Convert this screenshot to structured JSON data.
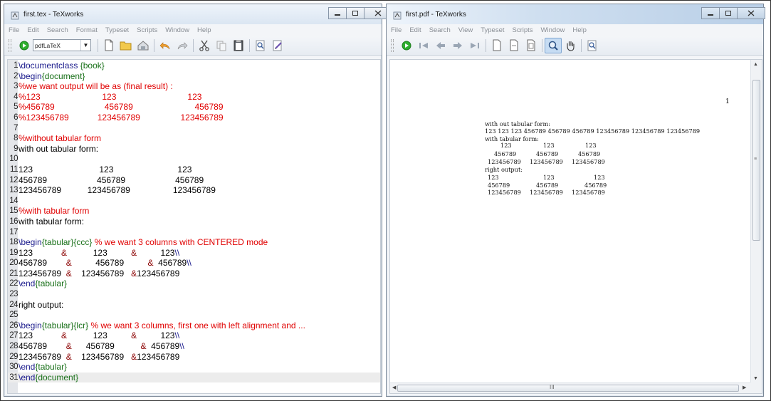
{
  "left_window": {
    "title": "first.tex - TeXworks",
    "menu": [
      "File",
      "Edit",
      "Search",
      "Format",
      "Typeset",
      "Scripts",
      "Window",
      "Help"
    ],
    "engine": "pdfLaTeX",
    "toolbar_icons": [
      "typeset-icon",
      "new-file-icon",
      "open-folder-icon",
      "save-icon",
      "undo-icon",
      "redo-icon",
      "cut-icon",
      "copy-icon",
      "paste-icon",
      "find-icon",
      "replace-icon"
    ]
  },
  "editor_lines": [
    {
      "n": "1",
      "tx": "",
      "segments": [
        {
          "t": "\\documentclass ",
          "c": "cmd"
        },
        {
          "t": "{book}",
          "c": "env"
        }
      ]
    },
    {
      "n": "2",
      "segments": [
        {
          "t": "\\begin",
          "c": "cmd"
        },
        {
          "t": "{document}",
          "c": "env"
        }
      ]
    },
    {
      "n": "3",
      "segments": [
        {
          "t": "%we want output will be as (final result) :",
          "c": "com"
        }
      ]
    },
    {
      "n": "4",
      "segments": [
        {
          "t": "%123                          123                              123",
          "c": "com"
        }
      ]
    },
    {
      "n": "5",
      "segments": [
        {
          "t": "%456789                     456789                          456789",
          "c": "com"
        }
      ]
    },
    {
      "n": "6",
      "segments": [
        {
          "t": "%123456789            123456789                 123456789",
          "c": "com"
        }
      ]
    },
    {
      "n": "7",
      "segments": []
    },
    {
      "n": "8",
      "segments": [
        {
          "t": "%without tabular form",
          "c": "com"
        }
      ]
    },
    {
      "n": "9",
      "segments": [
        {
          "t": "with out tabular form:",
          "c": "txt"
        }
      ]
    },
    {
      "n": "10",
      "segments": []
    },
    {
      "n": "11",
      "segments": [
        {
          "t": "123                            123                           123",
          "c": "txt"
        }
      ]
    },
    {
      "n": "12",
      "segments": [
        {
          "t": "456789                     456789                     456789",
          "c": "txt"
        }
      ]
    },
    {
      "n": "13",
      "segments": [
        {
          "t": "123456789           123456789                  123456789",
          "c": "txt"
        }
      ]
    },
    {
      "n": "14",
      "segments": []
    },
    {
      "n": "15",
      "segments": [
        {
          "t": "%with tabular form",
          "c": "com"
        }
      ]
    },
    {
      "n": "16",
      "segments": [
        {
          "t": "with tabular form:",
          "c": "txt"
        }
      ]
    },
    {
      "n": "17",
      "segments": []
    },
    {
      "n": "18",
      "segments": [
        {
          "t": "\\begin",
          "c": "cmd"
        },
        {
          "t": "{tabular}",
          "c": "env"
        },
        {
          "t": "{ccc} ",
          "c": "env"
        },
        {
          "t": "% we want 3 columns with CENTERED mode",
          "c": "com"
        }
      ]
    },
    {
      "n": "19",
      "segments": [
        {
          "t": "123            ",
          "c": "txt"
        },
        {
          "t": "&",
          "c": "amp"
        },
        {
          "t": "           123          ",
          "c": "txt"
        },
        {
          "t": "&",
          "c": "amp"
        },
        {
          "t": "          123",
          "c": "txt"
        },
        {
          "t": "\\\\",
          "c": "cmd"
        }
      ]
    },
    {
      "n": "20",
      "segments": [
        {
          "t": "456789        ",
          "c": "txt"
        },
        {
          "t": "&",
          "c": "amp"
        },
        {
          "t": "          456789          ",
          "c": "txt"
        },
        {
          "t": "&",
          "c": "amp"
        },
        {
          "t": "  456789",
          "c": "txt"
        },
        {
          "t": "\\\\",
          "c": "cmd"
        }
      ]
    },
    {
      "n": "21",
      "segments": [
        {
          "t": "123456789  ",
          "c": "txt"
        },
        {
          "t": "&",
          "c": "amp"
        },
        {
          "t": "    123456789   ",
          "c": "txt"
        },
        {
          "t": "&",
          "c": "amp"
        },
        {
          "t": "123456789",
          "c": "txt"
        }
      ]
    },
    {
      "n": "22",
      "segments": [
        {
          "t": "\\end",
          "c": "cmd"
        },
        {
          "t": "{tabular}",
          "c": "env"
        }
      ]
    },
    {
      "n": "23",
      "segments": []
    },
    {
      "n": "24",
      "segments": [
        {
          "t": "right output:",
          "c": "txt"
        }
      ]
    },
    {
      "n": "25",
      "segments": []
    },
    {
      "n": "26",
      "segments": [
        {
          "t": "\\begin",
          "c": "cmd"
        },
        {
          "t": "{tabular}",
          "c": "env"
        },
        {
          "t": "{lcr} ",
          "c": "env"
        },
        {
          "t": "% we want 3 columns, first one with left alignment and ...",
          "c": "com"
        }
      ]
    },
    {
      "n": "27",
      "segments": [
        {
          "t": "123            ",
          "c": "txt"
        },
        {
          "t": "&",
          "c": "amp"
        },
        {
          "t": "           123          ",
          "c": "txt"
        },
        {
          "t": "&",
          "c": "amp"
        },
        {
          "t": "          123",
          "c": "txt"
        },
        {
          "t": "\\\\",
          "c": "cmd"
        }
      ]
    },
    {
      "n": "28",
      "segments": [
        {
          "t": "456789        ",
          "c": "txt"
        },
        {
          "t": "&",
          "c": "amp"
        },
        {
          "t": "      456789           ",
          "c": "txt"
        },
        {
          "t": "&",
          "c": "amp"
        },
        {
          "t": "  456789",
          "c": "txt"
        },
        {
          "t": "\\\\",
          "c": "cmd"
        }
      ]
    },
    {
      "n": "29",
      "segments": [
        {
          "t": "123456789  ",
          "c": "txt"
        },
        {
          "t": "&",
          "c": "amp"
        },
        {
          "t": "    123456789   ",
          "c": "txt"
        },
        {
          "t": "&",
          "c": "amp"
        },
        {
          "t": "123456789",
          "c": "txt"
        }
      ]
    },
    {
      "n": "30",
      "segments": [
        {
          "t": "\\end",
          "c": "cmd"
        },
        {
          "t": "{tabular}",
          "c": "env"
        }
      ]
    },
    {
      "n": "31",
      "segments": [
        {
          "t": "\\end",
          "c": "cmd"
        },
        {
          "t": "{document}",
          "c": "env"
        }
      ],
      "current": true
    }
  ],
  "right_window": {
    "title": "first.pdf - TeXworks",
    "menu": [
      "File",
      "Edit",
      "Search",
      "View",
      "Typeset",
      "Scripts",
      "Window",
      "Help"
    ],
    "toolbar_icons": [
      "typeset-icon",
      "first-page-icon",
      "prev-page-icon",
      "next-page-icon",
      "last-page-icon",
      "actual-size-icon",
      "fit-width-icon",
      "fit-window-icon",
      "magnify-icon",
      "hand-icon",
      "find-icon"
    ]
  },
  "pdf": {
    "page_number": "1",
    "lines": [
      "with out tabular form:",
      "123 123 123 456789 456789 456789 123456789 123456789 123456789",
      "with tabular form:",
      "123",
      "123",
      "123",
      "456789",
      "456789",
      "456789",
      "123456789",
      "123456789",
      "123456789",
      "right output:",
      "123",
      "123",
      "123",
      "456789",
      "456789",
      "456789",
      "123456789",
      "123456789",
      "123456789"
    ],
    "hscroll_marker": "III",
    "vscroll_marker": "≡"
  }
}
